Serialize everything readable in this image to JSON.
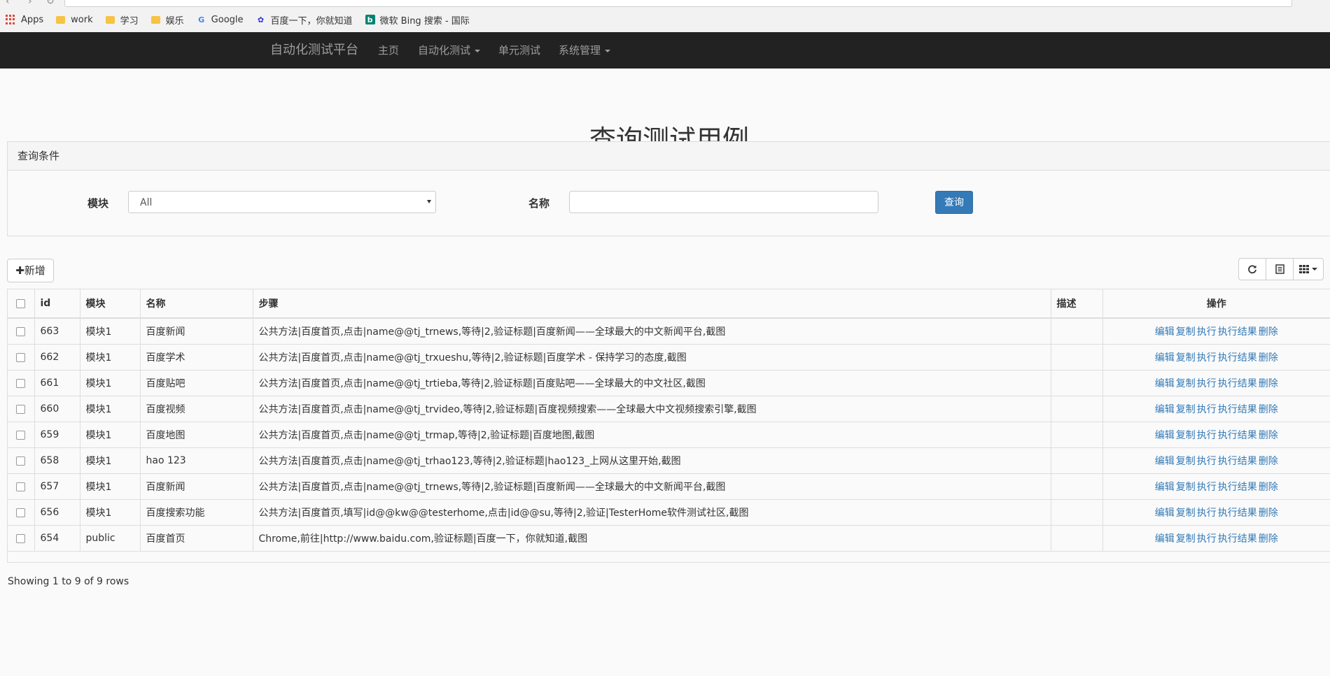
{
  "browser": {
    "bookmarks": [
      {
        "label": "Apps",
        "icon": "apps-grid-icon"
      },
      {
        "label": "work",
        "icon": "folder-icon"
      },
      {
        "label": "学习",
        "icon": "folder-icon"
      },
      {
        "label": "娱乐",
        "icon": "folder-icon"
      },
      {
        "label": "Google",
        "icon": "google-icon"
      },
      {
        "label": "百度一下，你就知道",
        "icon": "baidu-icon"
      },
      {
        "label": "微软 Bing 搜索 - 国际",
        "icon": "bing-icon"
      }
    ]
  },
  "navbar": {
    "brand": "自动化测试平台",
    "items": [
      "主页",
      "自动化测试",
      "单元测试",
      "系统管理"
    ]
  },
  "page": {
    "title": "查询测试用例"
  },
  "query": {
    "heading": "查询条件",
    "module_label": "模块",
    "module_value": "All",
    "name_label": "名称",
    "name_value": "",
    "submit_label": "查询"
  },
  "toolbar": {
    "add_label": "新增",
    "refresh_icon": "refresh-icon",
    "toggle_icon": "toggle-view-icon",
    "columns_icon": "columns-icon"
  },
  "table": {
    "headers": {
      "id": "id",
      "module": "模块",
      "name": "名称",
      "steps": "步骤",
      "desc": "描述",
      "ops": "操作"
    },
    "actions": [
      "编辑",
      "复制",
      "执行",
      "执行结果",
      "删除"
    ],
    "rows": [
      {
        "id": "663",
        "module": "模块1",
        "name": "百度新闻",
        "steps": "公共方法|百度首页,点击|name@@tj_trnews,等待|2,验证标题|百度新闻——全球最大的中文新闻平台,截图",
        "desc": ""
      },
      {
        "id": "662",
        "module": "模块1",
        "name": "百度学术",
        "steps": "公共方法|百度首页,点击|name@@tj_trxueshu,等待|2,验证标题|百度学术 - 保持学习的态度,截图",
        "desc": ""
      },
      {
        "id": "661",
        "module": "模块1",
        "name": "百度贴吧",
        "steps": "公共方法|百度首页,点击|name@@tj_trtieba,等待|2,验证标题|百度贴吧——全球最大的中文社区,截图",
        "desc": ""
      },
      {
        "id": "660",
        "module": "模块1",
        "name": "百度视频",
        "steps": "公共方法|百度首页,点击|name@@tj_trvideo,等待|2,验证标题|百度视频搜索——全球最大中文视频搜索引擎,截图",
        "desc": ""
      },
      {
        "id": "659",
        "module": "模块1",
        "name": "百度地图",
        "steps": "公共方法|百度首页,点击|name@@tj_trmap,等待|2,验证标题|百度地图,截图",
        "desc": ""
      },
      {
        "id": "658",
        "module": "模块1",
        "name": "hao 123",
        "steps": "公共方法|百度首页,点击|name@@tj_trhao123,等待|2,验证标题|hao123_上网从这里开始,截图",
        "desc": ""
      },
      {
        "id": "657",
        "module": "模块1",
        "name": "百度新闻",
        "steps": "公共方法|百度首页,点击|name@@tj_trnews,等待|2,验证标题|百度新闻——全球最大的中文新闻平台,截图",
        "desc": ""
      },
      {
        "id": "656",
        "module": "模块1",
        "name": "百度搜索功能",
        "steps": "公共方法|百度首页,填写|id@@kw@@testerhome,点击|id@@su,等待|2,验证|TesterHome软件测试社区,截图",
        "desc": ""
      },
      {
        "id": "654",
        "module": "public",
        "name": "百度首页",
        "steps": "Chrome,前往|http://www.baidu.com,验证标题|百度一下，你就知道,截图",
        "desc": ""
      }
    ]
  },
  "pagination": {
    "summary": "Showing 1 to 9 of 9 rows"
  }
}
